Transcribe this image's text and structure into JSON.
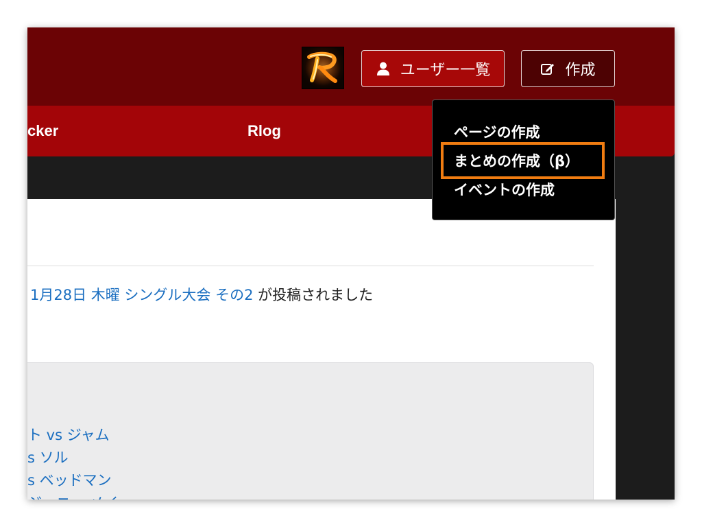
{
  "header": {
    "users_button_label": "ユーザー一覧",
    "create_button_label": "作成",
    "user_icon": "user-icon",
    "edit_icon": "edit-icon",
    "logo_letter": "R"
  },
  "nav": {
    "items": [
      {
        "label": "cker"
      },
      {
        "label": "Rlog"
      }
    ]
  },
  "dropdown": {
    "items": [
      {
        "label": "ページの作成"
      },
      {
        "label": "まとめの作成（β）"
      },
      {
        "label": "イベントの作成"
      }
    ],
    "highlighted_index": 1
  },
  "feed": {
    "post_link": "1月28日 木曜 シングル大会 その2",
    "post_suffix": " が投稿されました"
  },
  "card": {
    "matches": [
      {
        "label": "ト vs ジャム"
      },
      {
        "label": "s ソル"
      },
      {
        "label": "s ベッドマン"
      },
      {
        "label": "ジョニー メイ"
      }
    ]
  },
  "colors": {
    "header_bg": "#6b0305",
    "nav_bg": "#a30508",
    "users_button_bg": "#a70808",
    "create_button_bg": "#4d0203",
    "dropdown_bg": "#000000",
    "link": "#1a6ec0",
    "highlight": "#f07c11"
  }
}
